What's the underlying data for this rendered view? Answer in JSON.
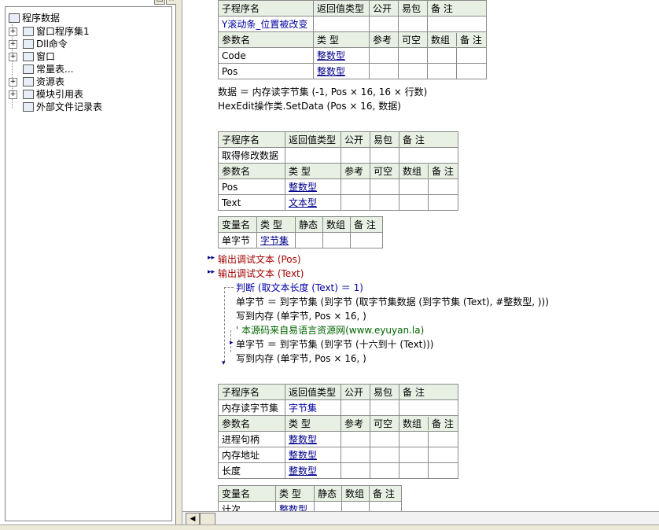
{
  "tree": {
    "root": "程序数据",
    "items": [
      {
        "label": "窗口程序集1",
        "expandable": true,
        "icon": "assembly-icon"
      },
      {
        "label": "Dll命令",
        "expandable": true,
        "icon": "dll-icon"
      },
      {
        "label": "窗口",
        "expandable": true,
        "icon": "window-icon"
      },
      {
        "label": "常量表...",
        "expandable": false,
        "icon": "constant-icon"
      },
      {
        "label": "资源表",
        "expandable": true,
        "icon": "resource-icon"
      },
      {
        "label": "模块引用表",
        "expandable": true,
        "icon": "module-icon"
      },
      {
        "label": "外部文件记录表",
        "expandable": false,
        "icon": "file-icon"
      }
    ]
  },
  "headers": {
    "sub": [
      "子程序名",
      "返回值类型",
      "公开",
      "易包",
      "备 注"
    ],
    "param": [
      "参数名",
      "类 型",
      "参考",
      "可空",
      "数组",
      "备 注"
    ],
    "var": [
      "变量名",
      "类 型",
      "静态",
      "数组",
      "备 注"
    ]
  },
  "proc1": {
    "name": "Y滚动条_位置被改变",
    "return_type": "",
    "params": [
      {
        "name": "Code",
        "type": "整数型"
      },
      {
        "name": "Pos",
        "type": "整数型"
      }
    ],
    "lines": [
      "数据 ＝ 内存读字节集 (-1, Pos × 16, 16 × 行数)",
      "HexEdit操作类.SetData (Pos × 16, 数据)"
    ]
  },
  "proc2": {
    "name": "取得修改数据",
    "return_type": "",
    "params": [
      {
        "name": "Pos",
        "type": "整数型"
      },
      {
        "name": "Text",
        "type": "文本型"
      }
    ],
    "vars": [
      {
        "name": "单字节",
        "type": "字节集"
      }
    ],
    "lines": [
      "输出调试文本 (Pos)",
      "输出调试文本 (Text)",
      "判断 (取文本长度 (Text) ＝ 1)",
      "单字节 ＝ 到字节集 (到字节 (取字节集数据 (到字节集 (Text), #整数型, )))",
      "写到内存 (单字节, Pos × 16, )",
      "' 本源码来自易语言资源网(www.eyuyan.la)",
      "单字节 ＝ 到字节集 (到字节 (十六到十 (Text)))",
      "写到内存 (单字节, Pos × 16, )"
    ]
  },
  "proc3": {
    "name": "内存读字节集",
    "return_type": "字节集",
    "params": [
      {
        "name": "进程句柄",
        "type": "整数型"
      },
      {
        "name": "内存地址",
        "type": "整数型"
      },
      {
        "name": "长度",
        "type": "整数型"
      }
    ],
    "vars": [
      {
        "name": "计次",
        "type": "整数型"
      }
    ]
  },
  "colors": {
    "header_bg": "#e8f0e4",
    "type_link": "#00008b",
    "command": "#a00000",
    "comment": "#006400"
  }
}
